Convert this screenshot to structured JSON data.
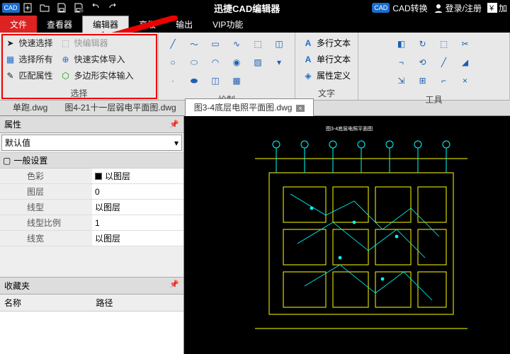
{
  "titlebar": {
    "app_title": "迅捷CAD编辑器",
    "cad_convert": "CAD转换",
    "login": "登录/注册",
    "icons": [
      "logo",
      "new",
      "open",
      "save",
      "saveas",
      "undo",
      "redo",
      "user",
      "renminbi"
    ]
  },
  "menubar": {
    "items": [
      {
        "label": "文件",
        "role": "file"
      },
      {
        "label": "查看器",
        "role": "viewer"
      },
      {
        "label": "编辑器",
        "role": "editor"
      },
      {
        "label": "高级",
        "role": "advanced"
      },
      {
        "label": "输出",
        "role": "output"
      },
      {
        "label": "VIP功能",
        "role": "vip"
      }
    ],
    "active": 2
  },
  "ribbon": {
    "selection": {
      "label": "选择",
      "items": [
        {
          "label": "快速选择",
          "icon": "cursor-green",
          "disabled": false,
          "name": "quick-select"
        },
        {
          "label": "快编辑器",
          "icon": "cursor-gray",
          "disabled": true,
          "name": "quick-editor"
        },
        {
          "label": "选择所有",
          "icon": "grid-blue",
          "disabled": false,
          "name": "select-all"
        },
        {
          "label": "快速实体导入",
          "icon": "import-blue",
          "disabled": false,
          "name": "quick-entity-import"
        },
        {
          "label": "匹配属性",
          "icon": "brush",
          "disabled": false,
          "name": "match-properties"
        },
        {
          "label": "多边形实体输入",
          "icon": "hex-green",
          "disabled": false,
          "name": "polygon-entity-input"
        }
      ]
    },
    "draw": {
      "label": "绘制"
    },
    "text": {
      "label": "文字",
      "multiline": "多行文本",
      "singleline": "单行文本",
      "attrdef": "属性定义"
    },
    "tools": {
      "label": "工具"
    }
  },
  "tabs": {
    "items": [
      {
        "label": "单跑.dwg",
        "active": false
      },
      {
        "label": "图4-21十一层弱电平面图.dwg",
        "active": false
      },
      {
        "label": "图3-4底层电照平面图.dwg",
        "active": true
      }
    ]
  },
  "panel": {
    "properties_title": "属性",
    "dropdown_value": "默认值",
    "section_general": "一般设置",
    "favorites_title": "收藏夹",
    "col_name": "名称",
    "col_path": "路径",
    "rows": [
      {
        "key": "色彩",
        "val": "以图层",
        "swatch": true
      },
      {
        "key": "图层",
        "val": "0"
      },
      {
        "key": "线型",
        "val": "以图层"
      },
      {
        "key": "线型比例",
        "val": "1"
      },
      {
        "key": "线宽",
        "val": "以图层"
      }
    ]
  },
  "canvas": {
    "title_block": "图3-4底层电照平面图"
  },
  "colors": {
    "accent_red": "#d22",
    "cad_yellow": "#ffff00",
    "cad_cyan": "#00ffff"
  }
}
